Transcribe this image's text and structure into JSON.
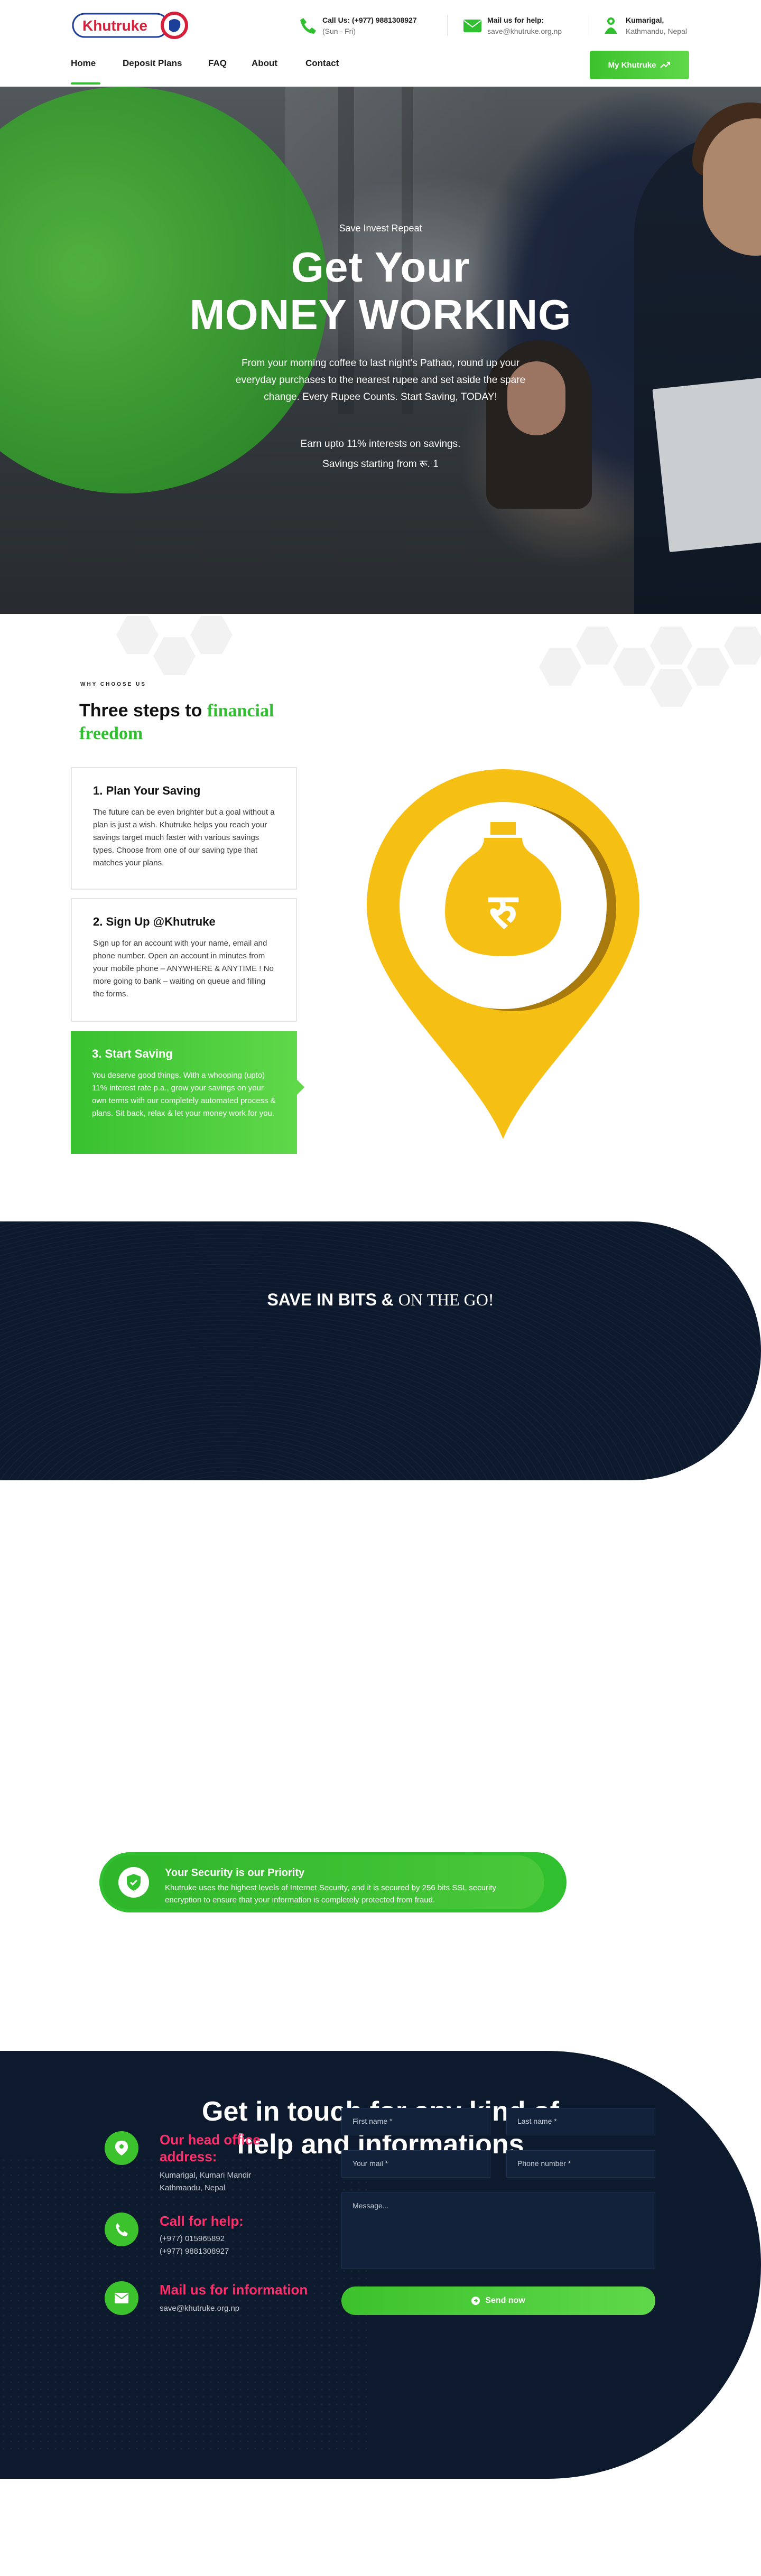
{
  "header": {
    "brand": "Khutruke",
    "call": {
      "title": "Call Us: (+977) 9881308927",
      "sub": "(Sun - Fri)"
    },
    "mail": {
      "title": "Mail us for help:",
      "sub": "save@khutruke.org.np"
    },
    "address": {
      "title": "Kumarigal,",
      "sub": "Kathmandu, Nepal"
    }
  },
  "nav": {
    "items": [
      "Home",
      "Deposit Plans",
      "FAQ",
      "About",
      "Contact"
    ],
    "active": "Home",
    "cta": "My Khutruke"
  },
  "hero": {
    "tagline": "Save  Invest  Repeat",
    "title_line1": "Get Your",
    "title_line2": "MONEY WORKING",
    "description": "From your morning coffee to last night's Pathao, round up your everyday purchases to the nearest rupee and set aside the spare change. Every Rupee Counts. Start Saving, TODAY!",
    "line1": "Earn upto 11% interests on savings.",
    "line2": "Savings starting from रू. 1"
  },
  "why": {
    "eyebrow": "WHY CHOOSE US",
    "title_part1": "Three steps to ",
    "title_part2": "financial freedom",
    "steps": [
      {
        "title": "1. Plan Your Saving",
        "desc": "The future can be even brighter but a goal without a plan is just a wish. Khutruke helps you reach your savings target much faster with various savings types. Choose from one of our saving type that matches your plans."
      },
      {
        "title": "2. Sign Up @Khutruke",
        "desc": "Sign up for an account with your name, email and phone number. Open an account in minutes from your mobile phone – ANYWHERE & ANYTIME ! No more going to bank – waiting on queue and filling the forms."
      },
      {
        "title": "3. Start Saving",
        "desc": "You deserve good things. With a whooping (upto) 11% interest rate p.a., grow your savings on your own terms with our completely automated process & plans. Sit back, relax & let your money work for you."
      }
    ]
  },
  "save_bits": {
    "part1": "SAVE IN BITS & ",
    "part2": "ON THE GO!"
  },
  "security": {
    "title": "Your Security is our Priority",
    "desc": "Khutruke uses the highest levels of Internet Security, and it is secured by 256 bits SSL security encryption to ensure that your information is completely protected from fraud."
  },
  "contact": {
    "title_line1": "Get in touch for any kind of",
    "title_line2": "help and informations",
    "office": {
      "title": "Our head office address:",
      "line1": "Kumarigal, Kumari Mandir",
      "line2": "Kathmandu, Nepal"
    },
    "call": {
      "title": "Call for help:",
      "line1": "(+977) 015965892",
      "line2": "(+977) 9881308927"
    },
    "mail": {
      "title": "Mail us for information",
      "line1": "save@khutruke.org.np"
    },
    "form": {
      "first_name": "First name *",
      "last_name": "Last name *",
      "email": "Your mail *",
      "phone": "Phone number *",
      "message": "Message...",
      "submit": "Send now"
    }
  },
  "colors": {
    "green": "#2fbf2f",
    "navy": "#0d1a2d",
    "pink": "#ff2f6b",
    "gold": "#f6bf14"
  }
}
